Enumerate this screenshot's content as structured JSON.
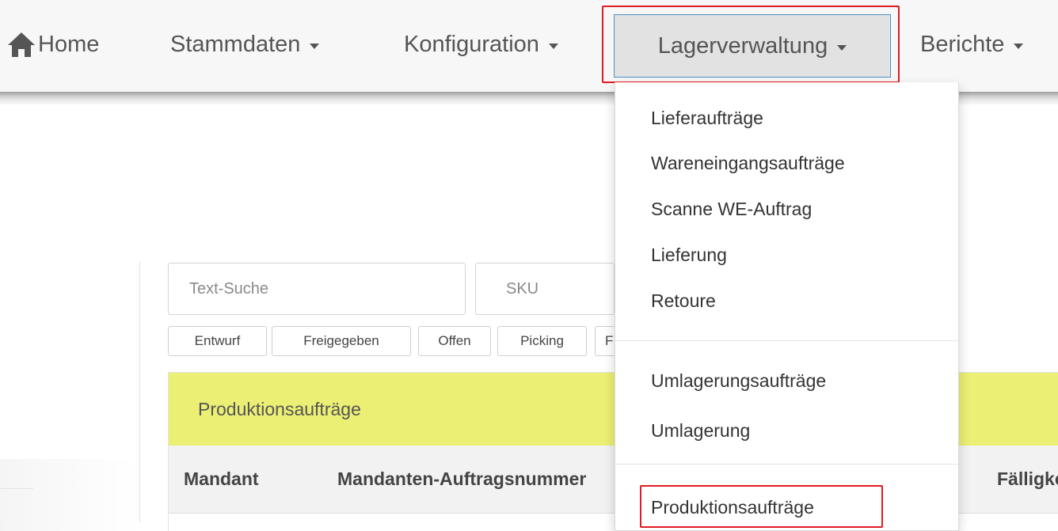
{
  "navbar": {
    "home_label": "Home",
    "stammdaten_label": "Stammdaten",
    "konfiguration_label": "Konfiguration",
    "lagerverwaltung_label": "Lagerverwaltung",
    "berichte_label": "Berichte",
    "home_icon": "home-icon",
    "caret_icon": "caret-down-icon"
  },
  "dropdown": {
    "group1": [
      "Lieferaufträge",
      "Wareneingangsaufträge",
      "Scanne WE-Auftrag",
      "Lieferung",
      "Retoure"
    ],
    "group2": [
      "Umlagerungsaufträge",
      "Umlagerung"
    ],
    "group3": [
      "Produktionsaufträge"
    ]
  },
  "filters": {
    "text_search_placeholder": "Text-Suche",
    "sku_placeholder": "SKU",
    "status_buttons": [
      "Entwurf",
      "Freigegeben",
      "Offen",
      "Picking",
      "F"
    ]
  },
  "panel": {
    "title": "Produktionsaufträge",
    "columns": [
      "Mandant",
      "Mandanten-Auftragsnummer",
      "Fälligkeitsdatum"
    ]
  },
  "colors": {
    "highlight_red": "#e21b23",
    "panel_heading": "#ebef74",
    "active_border": "#4a90c9"
  }
}
